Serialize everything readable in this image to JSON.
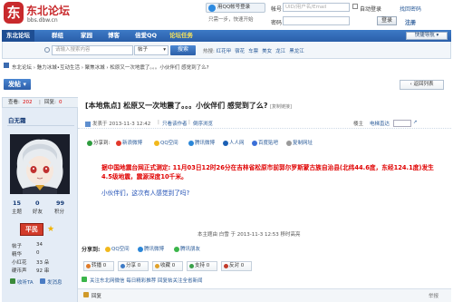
{
  "header": {
    "logo_char": "东",
    "logo_title": "东北论坛",
    "logo_url": "bbs.dbw.cn",
    "qq_login": "用QQ帐号登录",
    "qq_sub": "只需一步，快速开始",
    "login": {
      "account_label": "帐号",
      "account_placeholder": "UID/用户名/Email",
      "autologin": "自动登录",
      "forgot": "找回密码",
      "password_label": "密码",
      "login_btn": "登录",
      "register": "注册"
    }
  },
  "nav": {
    "items": [
      "东北论坛",
      "群组",
      "家园",
      "博客",
      "倍爱QQ",
      "论坛任务"
    ],
    "quick": "快捷导航"
  },
  "search": {
    "placeholder": "请输入搜索内容",
    "scope": "帖子",
    "button": "搜索",
    "hot_label": "热搜:",
    "hot_items": [
      "红花甲",
      "宿花",
      "车票",
      "美女",
      "龙江",
      "黑龙江"
    ]
  },
  "breadcrumb": "东北论坛 › 魅力冰城•互动生活 › 聚焦冰城 › 松原又一次地震了。。。小伙伴们 感觉到了么?",
  "post_btn": "发帖",
  "return_list": "返回列表",
  "stats": {
    "views_label": "查看:",
    "views": "202",
    "replies_label": "回复:",
    "replies": "0"
  },
  "thread": {
    "title": "[本地焦点] 松原又一次地震了。。。小伙伴们 感觉到了么?",
    "copy_link": "[复制链接]",
    "meta_posted": "发表于 2013-11-3 12:42",
    "meta_author_only": "只看该作者",
    "meta_reverse": "倒序浏览",
    "floor": "楼主",
    "jump_label": "电梯直达",
    "share_items": [
      "分享到:",
      "新浪微博",
      "QQ空间",
      "腾讯微博",
      "人人网",
      "百度贴吧",
      "复制网址"
    ],
    "body_red": "据中国地震台网正式测定: 11月03日12时26分在吉林省松原市前郭尔罗斯蒙古族自治县(北纬44.6度，东经124.1度)发生4.5级地震，震源深度10千米。",
    "body_blue": "小伙伴们，这次有人感觉到了吗?",
    "edited": "本主题由 白雪 于 2013-11-3 12:53 移时高亮",
    "share2_label": "分享到:",
    "share2_items": [
      "QQ空间",
      "腾讯微博",
      "腾讯朋友"
    ],
    "actions": [
      "转播 0",
      "分享 0",
      "收藏 0",
      "支持 0",
      "反对 0"
    ],
    "wechat": "关注东北网微信 每日精彩推荐 回复帖关注全省新闻",
    "reply_label": "回复",
    "report": "举报"
  },
  "author": {
    "name": "白无霜",
    "stats_values": [
      "15",
      "0",
      "99"
    ],
    "stats_labels": [
      "主题",
      "好友",
      "积分"
    ],
    "level": "平民",
    "details": [
      {
        "label": "帖子",
        "value": "34"
      },
      {
        "label": "精华",
        "value": "0"
      },
      {
        "label": "小红花",
        "value": "33 朵"
      },
      {
        "label": "硬币声",
        "value": "92 串"
      }
    ],
    "ta_link": "收听TA",
    "msg_link": "发消息"
  }
}
